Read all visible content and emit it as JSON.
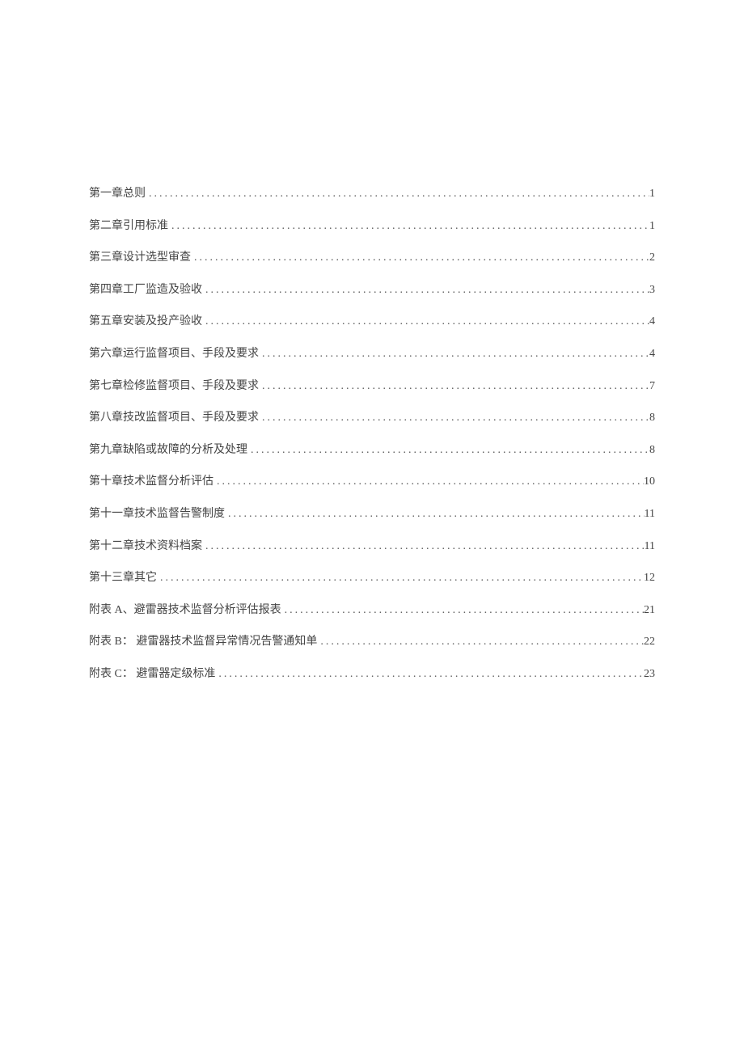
{
  "toc": [
    {
      "title": "第一章总则",
      "page": "1"
    },
    {
      "title": "第二章引用标准",
      "page": "1"
    },
    {
      "title": "第三章设计选型审查",
      "page": "2"
    },
    {
      "title": "第四章工厂监造及验收",
      "page": "3"
    },
    {
      "title": "第五章安装及投产验收",
      "page": "4"
    },
    {
      "title": "第六章运行监督项目、手段及要求",
      "page": "4"
    },
    {
      "title": "第七章检修监督项目、手段及要求",
      "page": "7"
    },
    {
      "title": "第八章技改监督项目、手段及要求",
      "page": "8"
    },
    {
      "title": "第九章缺陷或故障的分析及处理",
      "page": "8"
    },
    {
      "title": "第十章技术监督分析评估",
      "page": "10"
    },
    {
      "title": "第十一章技术监督告警制度",
      "page": "11"
    },
    {
      "title": "第十二章技术资料档案",
      "page": "11"
    },
    {
      "title": "第十三章其它",
      "page": "12"
    },
    {
      "title": "附表 A、避雷器技术监督分析评估报表",
      "page": "21"
    },
    {
      "title": "附表 B： 避雷器技术监督异常情况告警通知单",
      "page": "22"
    },
    {
      "title": "附表 C： 避雷器定级标准",
      "page": "23"
    }
  ]
}
